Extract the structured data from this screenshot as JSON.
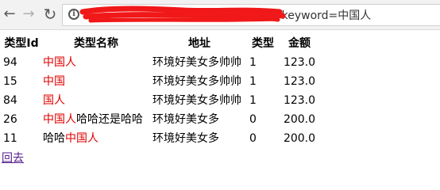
{
  "browser": {
    "url": "...?keyword=中国人",
    "url_visible_suffix": "om?keyword=中国人"
  },
  "table": {
    "headers": [
      "类型Id",
      "类型名称",
      "地址",
      "类型",
      "金额"
    ],
    "rows": [
      {
        "id": "94",
        "name": [
          {
            "text": "中国人",
            "highlight": true
          }
        ],
        "address": "环境好美女多帅帅",
        "type": "1",
        "amount": "123.0"
      },
      {
        "id": "15",
        "name": [
          {
            "text": "中国",
            "highlight": true
          }
        ],
        "address": "环境好美女多帅帅",
        "type": "1",
        "amount": "123.0"
      },
      {
        "id": "84",
        "name": [
          {
            "text": "国人",
            "highlight": true
          }
        ],
        "address": "环境好美女多帅帅",
        "type": "1",
        "amount": "123.0"
      },
      {
        "id": "26",
        "name": [
          {
            "text": "中国人",
            "highlight": true
          },
          {
            "text": "哈哈还是哈哈",
            "highlight": false
          }
        ],
        "address": "环境好美女多",
        "type": "0",
        "amount": "200.0"
      },
      {
        "id": "11",
        "name": [
          {
            "text": "哈哈",
            "highlight": false
          },
          {
            "text": "中国人",
            "highlight": true
          }
        ],
        "address": "环境好美女多",
        "type": "0",
        "amount": "200.0"
      }
    ]
  },
  "back_link": {
    "label": "回去"
  },
  "colors": {
    "highlight": "#e00000",
    "link": "#551a8b",
    "redaction": "#f01818"
  },
  "icons": {
    "back": "arrow-left-icon",
    "forward": "arrow-right-icon",
    "reload": "reload-icon",
    "info": "info-icon"
  }
}
